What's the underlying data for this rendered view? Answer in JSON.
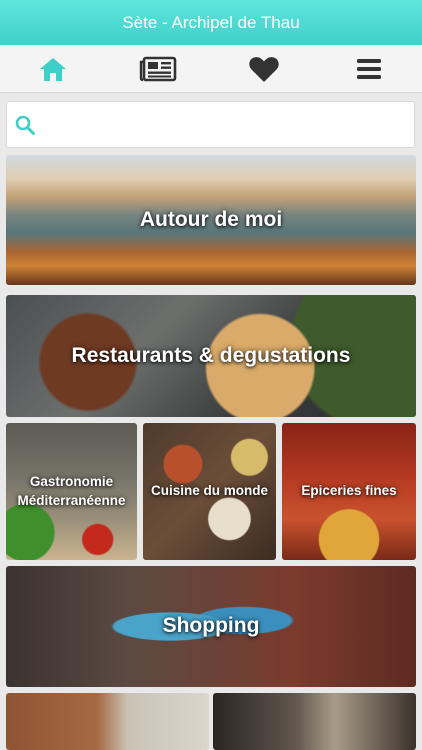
{
  "header": {
    "title": "Sète - Archipel de Thau"
  },
  "nav": {
    "items": [
      {
        "icon": "home-icon"
      },
      {
        "icon": "newspaper-icon"
      },
      {
        "icon": "heart-icon"
      },
      {
        "icon": "menu-icon"
      }
    ],
    "accent": "#3ecfc8",
    "icon_color": "#333333"
  },
  "search": {
    "placeholder": "",
    "value": ""
  },
  "categories": [
    {
      "label": "Autour de moi"
    },
    {
      "label": "Restaurants & degustations"
    },
    {
      "label": "Gastronomie Méditerranéenne"
    },
    {
      "label": "Cuisine du monde"
    },
    {
      "label": "Epiceries fines"
    },
    {
      "label": "Shopping"
    },
    {
      "label": ""
    },
    {
      "label": ""
    }
  ]
}
